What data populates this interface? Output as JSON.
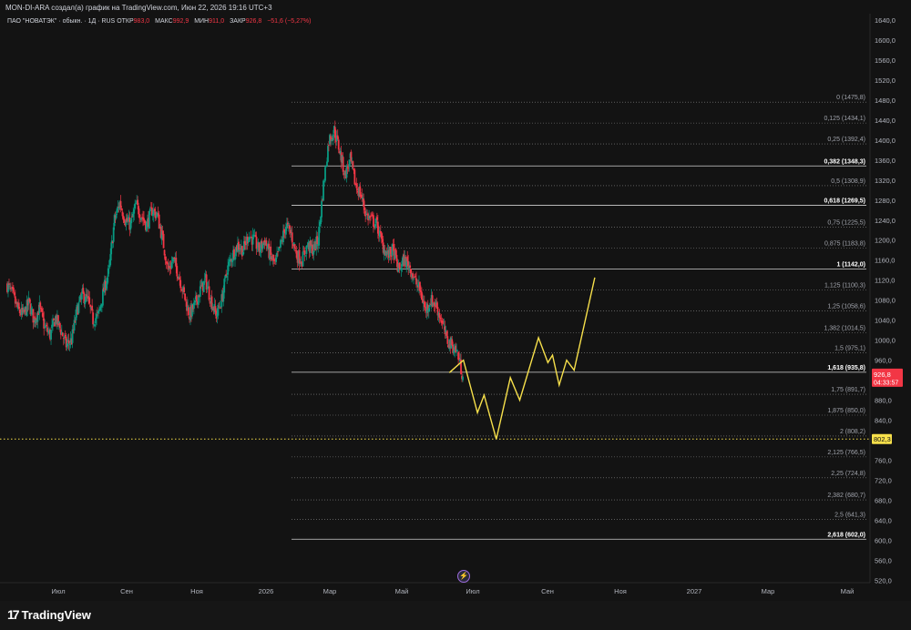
{
  "header": {
    "title": "MON-DI-ARA создал(а) график на TradingView.com, Июн 22, 2026 19:16 UTC+3"
  },
  "symbol": {
    "name": "ПАО \"НОВАТЭК\" · обыкн. · 1Д · RUS",
    "open_label": "ОТКР",
    "open_value": "983,0",
    "high_label": "МАКС",
    "high_value": "992,9",
    "low_label": "МИН",
    "low_value": "911,0",
    "close_label": "ЗАКР",
    "close_value": "926,8",
    "change": "−51,6 (−5,27%)"
  },
  "branding": {
    "logo_mark": "17",
    "logo_text": "TradingView"
  },
  "colors": {
    "background": "#131313",
    "up": "#089981",
    "down": "#f23645",
    "projection": "#f7e04b",
    "fib_line": "#8a8a8a"
  },
  "icons": {
    "event": "lightning-icon"
  },
  "chart_data": {
    "type": "candlestick",
    "ylim": [
      500,
      1640
    ],
    "y_ticks": [
      "1640,0",
      "1600,0",
      "1560,0",
      "1520,0",
      "1480,0",
      "1440,0",
      "1400,0",
      "1360,0",
      "1320,0",
      "1280,0",
      "1240,0",
      "1200,0",
      "1160,0",
      "1120,0",
      "1080,0",
      "1040,0",
      "1000,0",
      "960,0",
      "920,0",
      "880,0",
      "840,0",
      "800,0",
      "760,0",
      "720,0",
      "680,0",
      "640,0",
      "600,0",
      "560,0",
      "520,0"
    ],
    "x_ticks": [
      "Июл",
      "Сен",
      "Ноя",
      "2026",
      "Мар",
      "Май",
      "Июл",
      "Сен",
      "Ноя",
      "2027",
      "Мар",
      "Май"
    ],
    "last_price": {
      "value": "926,8",
      "countdown": "04:33:57"
    },
    "marker_price": "802,3",
    "fib_levels": [
      {
        "label": "0 (1475,8)",
        "price": 1475.8,
        "bold": false
      },
      {
        "label": "0,125 (1434,1)",
        "price": 1434.1,
        "bold": false
      },
      {
        "label": "0,25 (1392,4)",
        "price": 1392.4,
        "bold": false
      },
      {
        "label": "0,382 (1348,3)",
        "price": 1348.3,
        "bold": true
      },
      {
        "label": "0,5 (1308,9)",
        "price": 1308.9,
        "bold": false
      },
      {
        "label": "0,618 (1269,5)",
        "price": 1269.5,
        "bold": true
      },
      {
        "label": "0,75 (1225,5)",
        "price": 1225.5,
        "bold": false
      },
      {
        "label": "0,875 (1183,8)",
        "price": 1183.8,
        "bold": false
      },
      {
        "label": "1 (1142,0)",
        "price": 1142.0,
        "bold": true
      },
      {
        "label": "1,125 (1100,3)",
        "price": 1100.3,
        "bold": false
      },
      {
        "label": "1,25 (1058,6)",
        "price": 1058.6,
        "bold": false
      },
      {
        "label": "1,382 (1014,5)",
        "price": 1014.5,
        "bold": false
      },
      {
        "label": "1,5 (975,1)",
        "price": 975.1,
        "bold": false
      },
      {
        "label": "1,618 (935,8)",
        "price": 935.8,
        "bold": true
      },
      {
        "label": "1,75 (891,7)",
        "price": 891.7,
        "bold": false
      },
      {
        "label": "1,875 (850,0)",
        "price": 850.0,
        "bold": false
      },
      {
        "label": "2 (808,2)",
        "price": 808.2,
        "bold": false
      },
      {
        "label": "2,125 (766,5)",
        "price": 766.5,
        "bold": false
      },
      {
        "label": "2,25 (724,8)",
        "price": 724.8,
        "bold": false
      },
      {
        "label": "2,382 (680,7)",
        "price": 680.7,
        "bold": false
      },
      {
        "label": "2,5 (641,3)",
        "price": 641.3,
        "bold": false
      },
      {
        "label": "2,618 (602,0)",
        "price": 602.0,
        "bold": true
      }
    ],
    "price_path": [
      1110,
      1090,
      1060,
      1050,
      1075,
      1040,
      1065,
      1025,
      1010,
      1045,
      1020,
      990,
      1000,
      1060,
      1090,
      1080,
      1040,
      1050,
      1100,
      1140,
      1240,
      1275,
      1240,
      1230,
      1270,
      1250,
      1230,
      1260,
      1250,
      1200,
      1140,
      1160,
      1130,
      1090,
      1050,
      1070,
      1100,
      1120,
      1080,
      1050,
      1080,
      1140,
      1170,
      1190,
      1180,
      1210,
      1200,
      1180,
      1200,
      1170,
      1150,
      1190,
      1230,
      1210,
      1170,
      1160,
      1190,
      1180,
      1200,
      1310,
      1400,
      1420,
      1380,
      1330,
      1360,
      1310,
      1290,
      1250,
      1240,
      1230,
      1190,
      1170,
      1180,
      1140,
      1160,
      1150,
      1120,
      1100,
      1060,
      1080,
      1070,
      1040,
      1000,
      990,
      975,
      927
    ],
    "projection_path": [
      [
        -0.25,
        935
      ],
      [
        -0.1,
        960
      ],
      [
        0.05,
        855
      ],
      [
        0.12,
        890
      ],
      [
        0.25,
        802
      ],
      [
        0.4,
        925
      ],
      [
        0.5,
        880
      ],
      [
        0.7,
        1005
      ],
      [
        0.8,
        955
      ],
      [
        0.85,
        970
      ],
      [
        0.92,
        910
      ],
      [
        1.0,
        960
      ],
      [
        1.08,
        940
      ],
      [
        1.3,
        1125
      ]
    ]
  }
}
